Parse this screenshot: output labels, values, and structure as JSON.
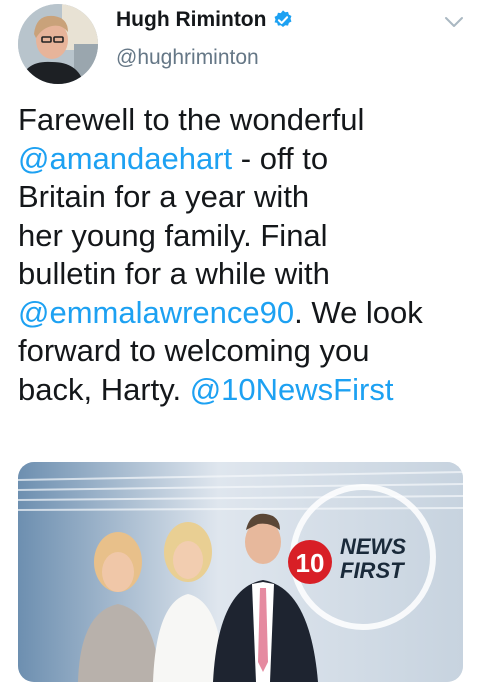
{
  "author": {
    "display_name": "Hugh Riminton",
    "handle": "@hughriminton",
    "verified": true,
    "avatar_icon": "avatar-photo"
  },
  "tweet": {
    "segments": [
      {
        "text": "Farewell to the wonderful\n",
        "type": "text"
      },
      {
        "text": "@amandaehart",
        "type": "mention"
      },
      {
        "text": " - off to\nBritain for a year with\nher young family. Final\nbulletin for a while with\n",
        "type": "text"
      },
      {
        "text": "@emmalawrence90",
        "type": "mention"
      },
      {
        "text": ". We look\nforward to welcoming you\nback, Harty. ",
        "type": "text"
      },
      {
        "text": "@10NewsFirst",
        "type": "mention"
      }
    ]
  },
  "media": {
    "logo_number": "10",
    "logo_line1": "NEWS",
    "logo_line2": "FIRST"
  },
  "colors": {
    "link": "#1da1f2",
    "secondary_text": "#657786",
    "verified": "#1da1f2"
  }
}
